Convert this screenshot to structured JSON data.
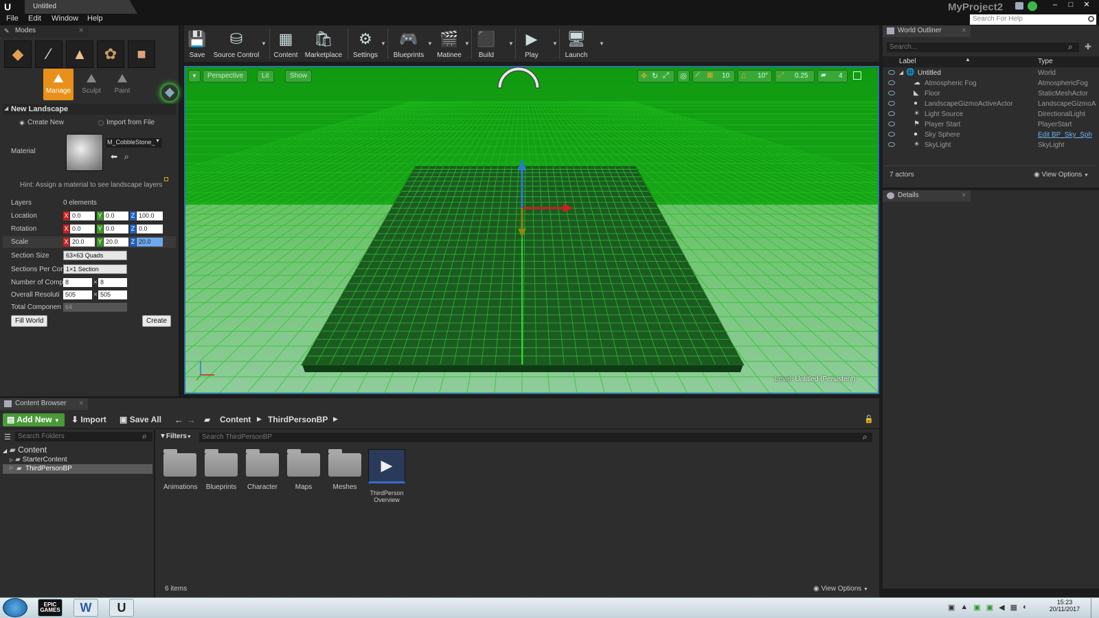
{
  "titlebar": {
    "doc_tab": "Untitled",
    "project": "MyProject2",
    "help_search_placeholder": "Search For Help"
  },
  "menu": [
    "File",
    "Edit",
    "Window",
    "Help"
  ],
  "modes": {
    "tab": "Modes",
    "sub_tools": [
      "Manage",
      "Sculpt",
      "Paint"
    ],
    "section": "New Landscape",
    "create_new": "Create New",
    "import_from_file": "Import from File",
    "material_label": "Material",
    "material_value": "M_CobbleStone_",
    "hint": "Hint: Assign a material to see landscape layers",
    "layers_label": "Layers",
    "layers_value": "0 elements",
    "location_label": "Location",
    "location": {
      "x": "0.0",
      "y": "0.0",
      "z": "100.0"
    },
    "rotation_label": "Rotation",
    "rotation": {
      "x": "0.0",
      "y": "0.0",
      "z": "0.0"
    },
    "scale_label": "Scale",
    "scale": {
      "x": "20.0",
      "y": "20.0",
      "z": "20.0"
    },
    "section_size_label": "Section Size",
    "section_size": "63×63 Quads",
    "sections_per_label": "Sections Per Con",
    "sections_per": "1×1 Section",
    "num_comp_label": "Number of Comp",
    "num_comp": {
      "a": "8",
      "b": "8"
    },
    "overall_res_label": "Overall Resoluti",
    "overall_res": {
      "a": "505",
      "b": "505"
    },
    "total_comp_label": "Total Componen",
    "total_comp": "64",
    "fill_world": "Fill World",
    "create": "Create"
  },
  "toolbar": [
    "Save",
    "Source Control",
    "Content",
    "Marketplace",
    "Settings",
    "Blueprints",
    "Matinee",
    "Build",
    "Play",
    "Launch"
  ],
  "viewport": {
    "perspective": "Perspective",
    "lit": "Lit",
    "show": "Show",
    "grid_snap": "10",
    "rot_snap": "10°",
    "scale_snap": "0.25",
    "cam_speed": "4",
    "level_label": "Level:",
    "level_value": "Untitled (Persistent)"
  },
  "outliner": {
    "tab": "World Outliner",
    "search_placeholder": "Search...",
    "col_label": "Label",
    "col_type": "Type",
    "rows": [
      {
        "label": "Untitled",
        "type": "World"
      },
      {
        "label": "Atmospheric Fog",
        "type": "AtmosphericFog"
      },
      {
        "label": "Floor",
        "type": "StaticMeshActor"
      },
      {
        "label": "LandscapeGizmoActiveActor",
        "type": "LandscapeGizmoA"
      },
      {
        "label": "Light Source",
        "type": "DirectionalLight"
      },
      {
        "label": "Player Start",
        "type": "PlayerStart"
      },
      {
        "label": "Sky Sphere",
        "type": "Edit BP_Sky_Sph"
      },
      {
        "label": "SkyLight",
        "type": "SkyLight"
      }
    ],
    "count": "7 actors",
    "view_options": "View Options"
  },
  "details": {
    "tab": "Details"
  },
  "content_browser": {
    "tab": "Content Browser",
    "add_new": "Add New",
    "import": "Import",
    "save_all": "Save All",
    "path": [
      "Content",
      "ThirdPersonBP"
    ],
    "search_folders_placeholder": "Search Folders",
    "filters": "Filters",
    "search_assets_placeholder": "Search ThirdPersonBP",
    "tree": [
      "Content",
      "StarterContent",
      "ThirdPersonBP"
    ],
    "assets": [
      "Animations",
      "Blueprints",
      "Character",
      "Maps",
      "Meshes"
    ],
    "special_asset_line1": "ThirdPerson",
    "special_asset_line2": "Overview",
    "count": "6 items",
    "view_options": "View Options"
  },
  "taskbar": {
    "time": "15:23",
    "date": "20/11/2017",
    "epic": "EPIC GAMES",
    "word": "W"
  }
}
